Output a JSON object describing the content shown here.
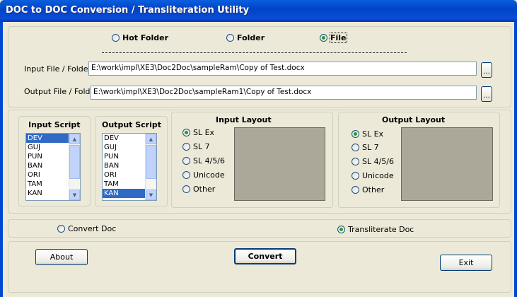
{
  "window": {
    "title": "DOC to DOC Conversion / Transliteration Utility"
  },
  "mode": {
    "options": [
      {
        "label": "Hot Folder",
        "selected": false
      },
      {
        "label": "Folder",
        "selected": false
      },
      {
        "label": "File",
        "selected": true
      }
    ]
  },
  "paths": {
    "input_label": "Input File / Folder",
    "input_value": "E:\\work\\impl\\XE3\\Doc2Doc\\sampleRam\\Copy of Test.docx",
    "output_label": "Output File / Folder",
    "output_value": "E:\\work\\impl\\XE3\\Doc2Doc\\sampleRam1\\Copy of Test.docx",
    "browse_label": "..."
  },
  "scripts": {
    "input_title": "Input Script",
    "output_title": "Output Script",
    "input_items": [
      "DEV",
      "GUJ",
      "PUN",
      "BAN",
      "ORI",
      "TAM",
      "KAN"
    ],
    "input_selected": "DEV",
    "output_items": [
      "DEV",
      "GUJ",
      "PUN",
      "BAN",
      "ORI",
      "TAM",
      "KAN"
    ],
    "output_selected": "KAN"
  },
  "layouts": {
    "input_title": "Input Layout",
    "output_title": "Output Layout",
    "options": [
      "SL Ex",
      "SL 7",
      "SL 4/5/6",
      "Unicode",
      "Other"
    ],
    "input_selected": "SL Ex",
    "output_selected": "SL Ex"
  },
  "operation": {
    "convert_label": "Convert Doc",
    "transliterate_label": "Transliterate Doc",
    "selected": "Transliterate Doc"
  },
  "buttons": {
    "about": "About",
    "convert": "Convert",
    "exit": "Exit"
  },
  "colors": {
    "titlebar": "#0a4cd6",
    "selection": "#316ac5",
    "radio_dot": "#21a121",
    "preview_box": "#aca899"
  }
}
